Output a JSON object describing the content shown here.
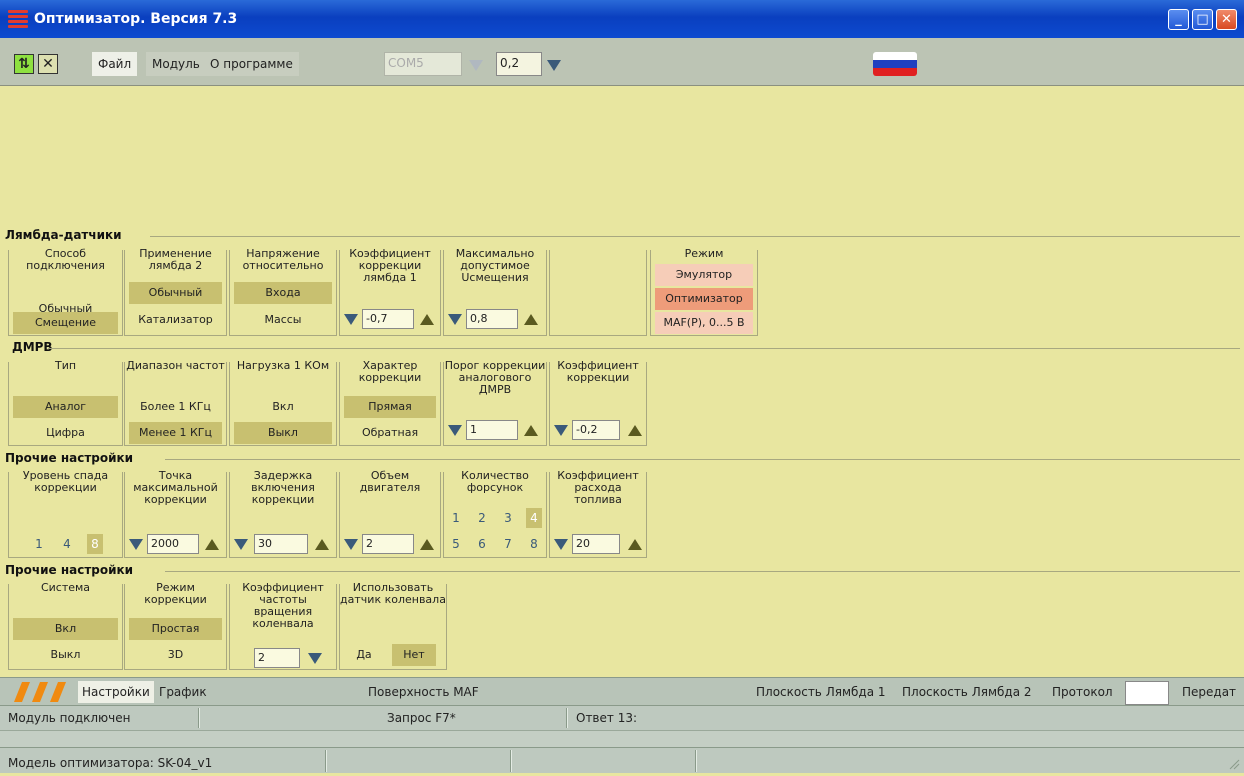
{
  "window": {
    "title": "Оптимизатор. Версия 7.3"
  },
  "toolbar": {
    "menu": [
      "Файл",
      "Модуль",
      "О программе"
    ],
    "port": "COM5",
    "step": "0,2"
  },
  "lambda": {
    "title": "Лямбда-датчики",
    "g1": {
      "title": "Способ подключения",
      "opts": [
        "Обычный",
        "Смещение"
      ]
    },
    "g2": {
      "title": "Применение лямбда 2",
      "opts": [
        "Обычный",
        "Катализатор"
      ]
    },
    "g3": {
      "title": "Напряжение относительно",
      "opts": [
        "Входа",
        "Массы"
      ]
    },
    "g4": {
      "title": "Коэффициент коррекции лямбда 1",
      "value": "-0,7"
    },
    "g5": {
      "title": "Максимально допустимое Uсмещения",
      "value": "0,8"
    },
    "g7": {
      "title": "Режим",
      "opts": [
        "Эмулятор",
        "Оптимизатор",
        "MAF(P), 0...5 В"
      ]
    }
  },
  "dmrv": {
    "title": "ДМРВ",
    "g1": {
      "title": "Тип",
      "opts": [
        "Аналог",
        "Цифра"
      ]
    },
    "g2": {
      "title": "Диапазон частот",
      "opts": [
        "Более 1 КГц",
        "Менее 1 КГц"
      ]
    },
    "g3": {
      "title": "Нагрузка 1 КОм",
      "opts": [
        "Вкл",
        "Выкл"
      ]
    },
    "g4": {
      "title": "Характер коррекции",
      "opts": [
        "Прямая",
        "Обратная"
      ]
    },
    "g5": {
      "title": "Порог коррекции аналогового ДМРВ",
      "value": "1"
    },
    "g6": {
      "title": "Коэффициент коррекции",
      "value": "-0,2"
    }
  },
  "other1": {
    "title": "Прочие настройки",
    "g1": {
      "title": "Уровень спада коррекции",
      "opts": [
        "1",
        "4",
        "8"
      ]
    },
    "g2": {
      "title": "Точка максимальной коррекции",
      "value": "2000"
    },
    "g3": {
      "title": "Задержка включения коррекции",
      "value": "30"
    },
    "g4": {
      "title": "Объем двигателя",
      "value": "2"
    },
    "g5": {
      "title": "Количество форсунок",
      "opts": [
        "1",
        "2",
        "3",
        "4",
        "5",
        "6",
        "7",
        "8"
      ]
    },
    "g6": {
      "title": "Коэффициент расхода топлива",
      "value": "20"
    }
  },
  "other2": {
    "title": "Прочие настройки",
    "g1": {
      "title": "Система",
      "opts": [
        "Вкл",
        "Выкл"
      ]
    },
    "g2": {
      "title": "Режим коррекции",
      "opts": [
        "Простая",
        "3D"
      ]
    },
    "g3": {
      "title": "Коэффициент частоты вращения коленвала",
      "value": "2"
    },
    "g4": {
      "title": "Использовать датчик коленвала",
      "opts": [
        "Да",
        "Нет"
      ]
    }
  },
  "tabs": {
    "settings": "Настройки",
    "graph": "График",
    "maf": "Поверхность MAF",
    "plane1": "Плоскость Лямбда 1",
    "plane2": "Плоскость Лямбда 2",
    "protocol": "Протокол",
    "send": "Передат"
  },
  "status": {
    "module": "Модуль подключен",
    "request": "Запрос F7*",
    "answer": "Ответ 13:",
    "model": "Модель оптимизатора: SK-04_v1"
  },
  "colors": {
    "panel": "#e8e6a0",
    "selected": "#c8c070",
    "emulator": "#f6cdb8",
    "optimizer": "#ee9c7a"
  }
}
